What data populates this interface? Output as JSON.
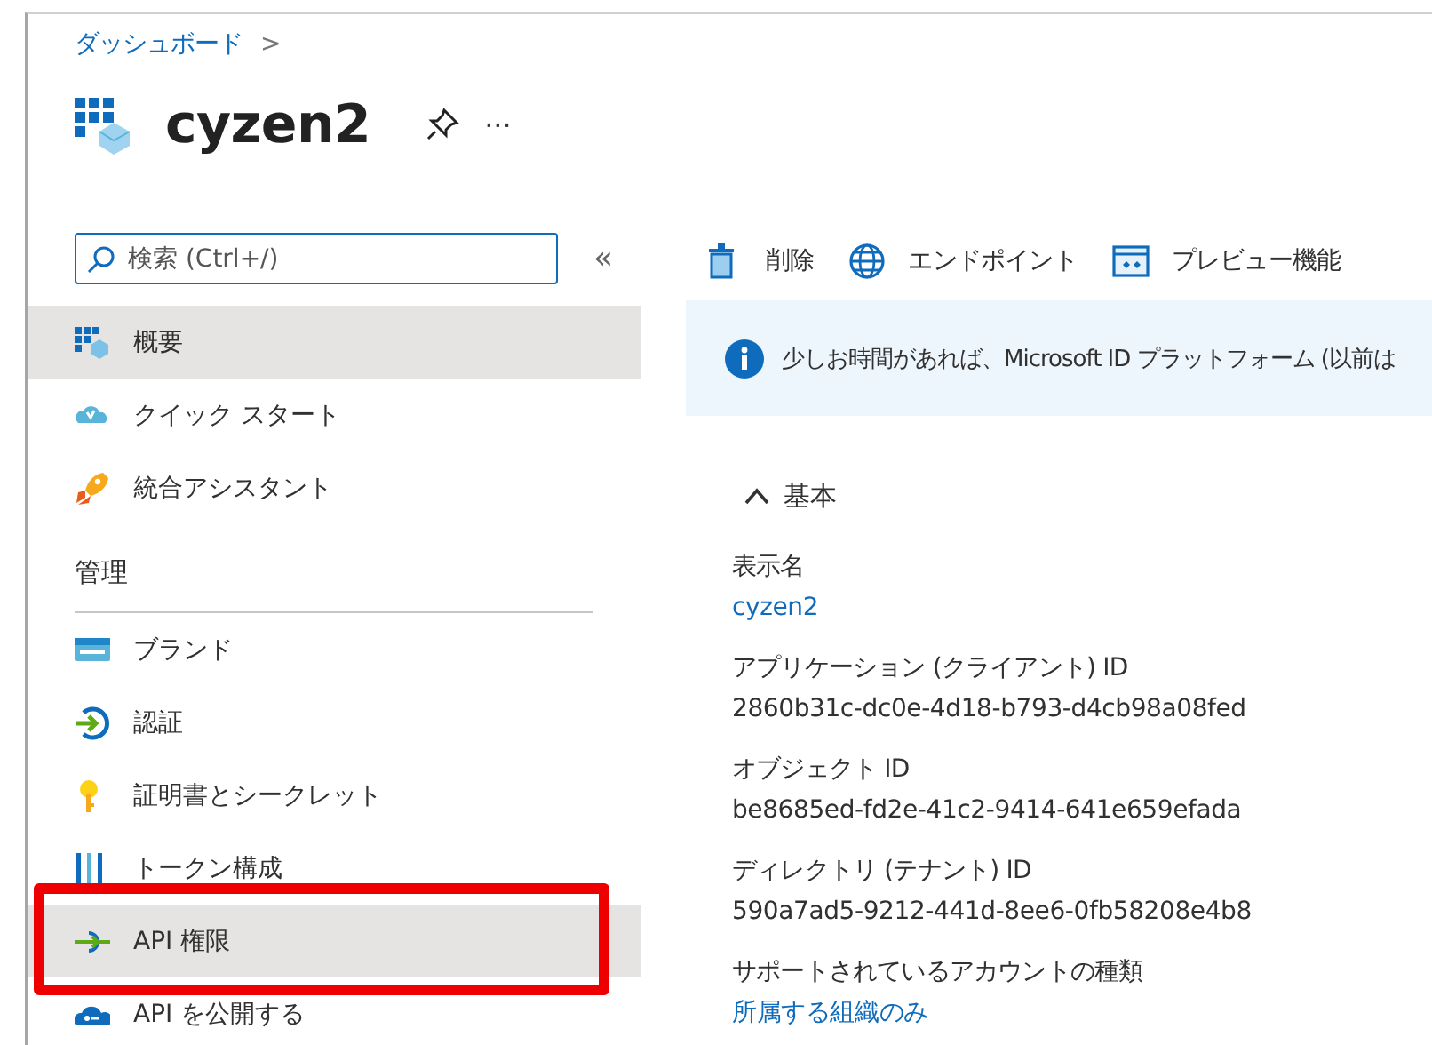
{
  "breadcrumb": [
    {
      "label": "ダッシュボード",
      "separator": ">"
    }
  ],
  "title": "cyzen2",
  "title_actions": {
    "more": "···"
  },
  "search": {
    "placeholder": "検索 (Ctrl+/)",
    "collapse": "«"
  },
  "sidebar": {
    "items": [
      {
        "kind": "item",
        "label": "概要",
        "selected": true
      },
      {
        "kind": "item",
        "label": "クイック スタート",
        "selected": false
      },
      {
        "kind": "item",
        "label": "統合アシスタント",
        "selected": false
      },
      {
        "kind": "header",
        "label": "管理"
      },
      {
        "kind": "item",
        "label": "ブランド",
        "selected": false
      },
      {
        "kind": "item",
        "label": "認証",
        "selected": false
      },
      {
        "kind": "item",
        "label": "証明書とシークレット",
        "selected": false
      },
      {
        "kind": "item",
        "label": "トークン構成",
        "selected": false
      },
      {
        "kind": "item",
        "label": "API 権限",
        "selected": true,
        "annotated": true
      },
      {
        "kind": "item",
        "label": "API を公開する",
        "selected": false
      }
    ]
  },
  "toolbar": [
    {
      "label": "削除"
    },
    {
      "label": "エンドポイント"
    },
    {
      "label": "プレビュー機能"
    }
  ],
  "banner": {
    "text": "少しお時間があれば、Microsoft ID プラットフォーム (以前は"
  },
  "essentials": {
    "heading": "基本",
    "expanded": true,
    "fields": [
      {
        "label": "表示名",
        "value": "cyzen2",
        "link": true
      },
      {
        "label": "アプリケーション (クライアント) ID",
        "value": "2860b31c-dc0e-4d18-b793-d4cb98a08fed",
        "link": false
      },
      {
        "label": "オブジェクト ID",
        "value": "be8685ed-fd2e-41c2-9414-641e659efada",
        "link": false
      },
      {
        "label": "ディレクトリ (テナント) ID",
        "value": "590a7ad5-9212-441d-8ee6-0fb58208e4b8",
        "link": false
      },
      {
        "label": "サポートされているアカウントの種類",
        "value": "所属する組織のみ",
        "link": true
      }
    ]
  }
}
